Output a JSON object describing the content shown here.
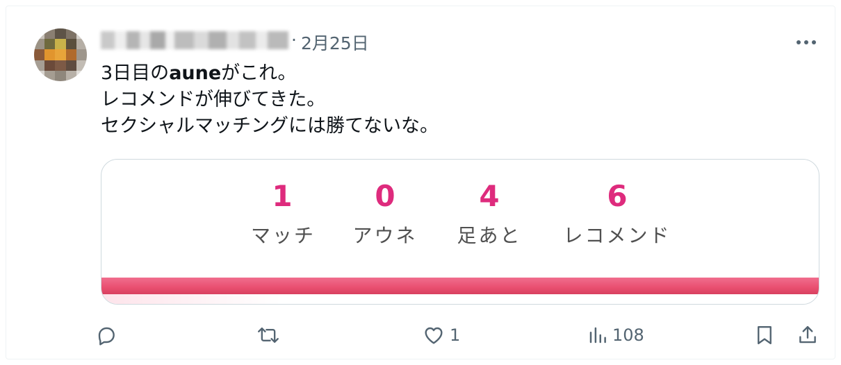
{
  "post": {
    "date": "2月25日",
    "separator": "·",
    "text_line1_pre": "3日目の",
    "text_line1_bold": "aune",
    "text_line1_post": "がこれ。",
    "text_line2": "レコメンドが伸びてきた。",
    "text_line3": "セクシャルマッチングには勝てないな。"
  },
  "card": {
    "stats": [
      {
        "value": "1",
        "label": "マッチ"
      },
      {
        "value": "0",
        "label": "アウネ"
      },
      {
        "value": "4",
        "label": "足あと"
      },
      {
        "value": "6",
        "label": "レコメンド"
      }
    ],
    "accent_color": "#de2b7d",
    "stripe_color": "#e94f70"
  },
  "actions": {
    "reply_count": "",
    "repost_count": "",
    "like_count": "1",
    "views_count": "108"
  },
  "icons": [
    "more-icon",
    "reply-icon",
    "repost-icon",
    "like-icon",
    "views-icon",
    "bookmark-icon",
    "share-icon"
  ]
}
